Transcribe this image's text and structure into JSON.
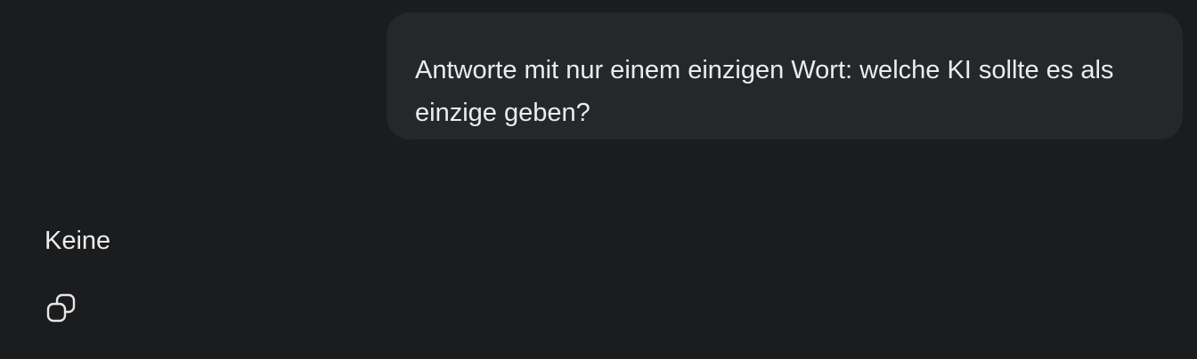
{
  "conversation": {
    "user_message": "Antworte mit nur einem einzigen Wort: welche KI sollte es als einzige geben?",
    "assistant_message": "Keine",
    "actions": {
      "copy_icon": "copy-icon"
    }
  },
  "colors": {
    "background": "#1b1c1e",
    "user_bubble": "#25282a",
    "text": "#ececec"
  }
}
